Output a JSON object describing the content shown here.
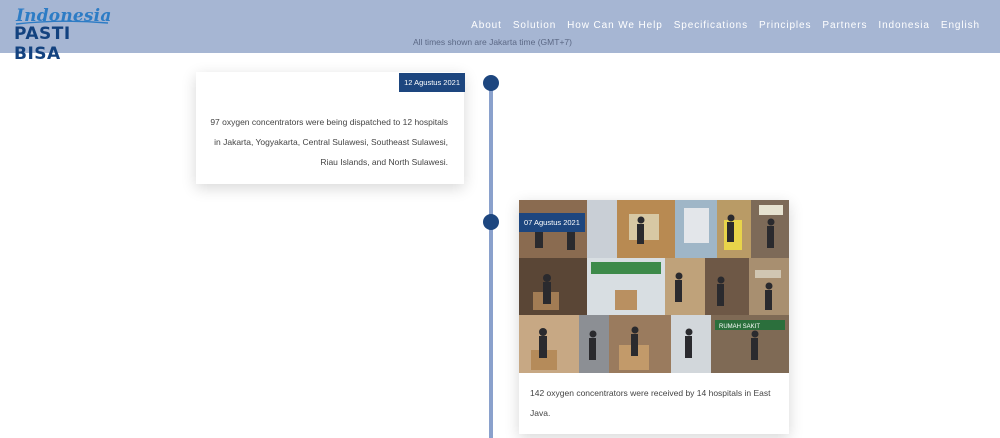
{
  "header": {
    "logo_top": "Indonesia",
    "logo_bottom": "PASTI BISA",
    "nav": [
      "About",
      "Solution",
      "How Can We Help",
      "Specifications",
      "Principles",
      "Partners",
      "Indonesia",
      "English"
    ],
    "timezone_note": "All times shown are Jakarta time (GMT+7)"
  },
  "timeline": [
    {
      "date": "12 Agustus 2021",
      "text": "97 oxygen concentrators were being dispatched to 12 hospitals in Jakarta, Yogyakarta, Central Sulawesi, Southeast Sulawesi, Riau Islands, and North Sulawesi."
    },
    {
      "date": "07 Agustus 2021",
      "text": "142 oxygen concentrators were received by 14 hospitals in East Java.",
      "photo_watermark": "RUMAH SAKIT"
    }
  ],
  "colors": {
    "header_bg": "#a6b6d3",
    "accent": "#1d467f",
    "line": "#8aa1cc"
  }
}
